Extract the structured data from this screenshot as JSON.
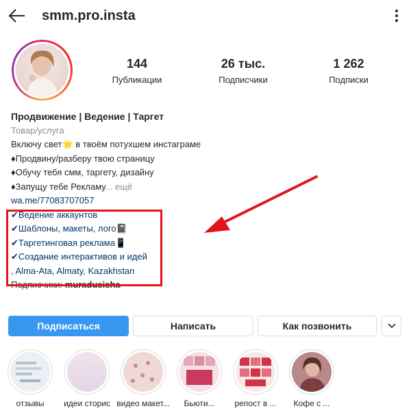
{
  "header": {
    "username": "smm.pro.insta",
    "back_icon": "arrow-left-icon",
    "menu_icon": "more-vertical-icon"
  },
  "stats": [
    {
      "value": "144",
      "label": "Публикации"
    },
    {
      "value": "26 тыс.",
      "label": "Подписчики"
    },
    {
      "value": "1 262",
      "label": "Подписки"
    }
  ],
  "bio": {
    "name": "Продвижение | Ведение | Таргет",
    "category": "Товар/услуга",
    "line1": "Включу свет🌟 в твоём потухшем инстаграме",
    "line2": "♦Продвину/разберу твою страницу",
    "line3": "♦Обучу тебя смм, таргету, дизайну",
    "line4": "♦Запущу тебе Рекламу",
    "more": "... ещё",
    "link": "wa.me/77083707057",
    "services": [
      "✔Ведение аккаунтов",
      "✔Шаблоны, макеты, лого📓",
      "✔Таргетинговая реклама📱",
      "✔Создание интерактивов и идей"
    ],
    "location": ", Alma-Ata, Almaty, Kazakhstan",
    "followers_prefix": "Подписчики: ",
    "followers_name": "muradusisha"
  },
  "buttons": {
    "follow": "Подписаться",
    "message": "Написать",
    "call": "Как позвонить",
    "more_icon": "chevron-down-icon"
  },
  "highlights": [
    {
      "label": "отзывы"
    },
    {
      "label": "идеи сторис"
    },
    {
      "label": "видео макет..."
    },
    {
      "label": "Бьюти..."
    },
    {
      "label": "репост в ..."
    },
    {
      "label": "Кофе с ..."
    }
  ],
  "colors": {
    "accent": "#3897f0",
    "annotation": "#e2141b",
    "link": "#003569"
  }
}
